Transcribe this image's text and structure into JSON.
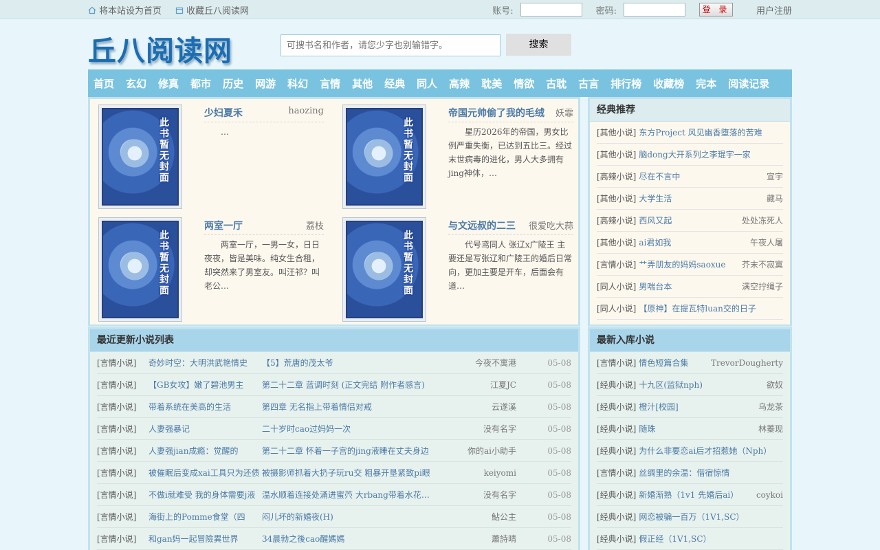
{
  "topbar": {
    "set_home": "将本站设为首页",
    "bookmark": "收藏丘八阅读网",
    "account_label": "账号:",
    "password_label": "密码:",
    "login_button": "登 录",
    "register": "用户注册"
  },
  "header": {
    "logo": "丘八阅读网",
    "search_placeholder": "可搜书名和作者，请您少字也别输错字。",
    "search_button": "搜索"
  },
  "nav": [
    "首页",
    "玄幻",
    "修真",
    "都市",
    "历史",
    "网游",
    "科幻",
    "言情",
    "其他",
    "经典",
    "同人",
    "高辣",
    "耽美",
    "情欲",
    "古耽",
    "古言",
    "排行榜",
    "收藏榜",
    "完本",
    "阅读记录"
  ],
  "cover_text": "此书暂无封面",
  "featured": [
    {
      "title": "少妇夏禾",
      "author": "haozing",
      "desc": "…"
    },
    {
      "title": "帝国元帅偷了我的毛绒",
      "author": "妖霏",
      "desc": "星历2026年的帝国，男女比例严重失衡，已达到五比三。经过末世病毒的进化，男人大多拥有jing神体，…"
    },
    {
      "title": "两室一厅",
      "author": "荔枝",
      "desc": "两室一厅，一男一女，日日夜夜，皆是美味。纯女生合租，却突然来了男室友。叫汪祁？叫老公…"
    },
    {
      "title": "与文远叔的二三",
      "author": "很爱吃大蒜",
      "desc": "代号鸢同人 张辽x广陵王 主要还是写张辽和广陵王的婚后日常向，更加主要是开车，后面会有道…"
    }
  ],
  "classic": {
    "heading": "经典推荐",
    "items": [
      {
        "cat": "[其他小说]",
        "title": "东方Project 风见幽香堕落的苦难",
        "author": ""
      },
      {
        "cat": "[其他小说]",
        "title": "脑dong大开系列之李琨宇一家",
        "author": ""
      },
      {
        "cat": "[高辣小说]",
        "title": "尽在不言中",
        "author": "宣宇"
      },
      {
        "cat": "[其他小说]",
        "title": "大学生活",
        "author": "藏马"
      },
      {
        "cat": "[高辣小说]",
        "title": "西风又起",
        "author": "处处冻死人"
      },
      {
        "cat": "[其他小说]",
        "title": "ai君如我",
        "author": "午夜人屠"
      },
      {
        "cat": "[言情小说]",
        "title": "艹弄朋友的妈妈saoxue",
        "author": "芥末不寂寞"
      },
      {
        "cat": "[同人小说]",
        "title": "男喘台本",
        "author": "满空拧绳子"
      },
      {
        "cat": "[同人小说]",
        "title": "【原神】在提瓦特luan交的日子",
        "author": ""
      }
    ]
  },
  "latest": {
    "heading": "最近更新小说列表",
    "rows": [
      {
        "cat": "[言情小说]",
        "title": "奇妙时空：大明洪武艳情史",
        "chapter": "【5】荒唐的茂太爷",
        "author": "今夜不寓港",
        "date": "05-08"
      },
      {
        "cat": "[言情小说]",
        "title": "【GB女攻】嫩了碧池男主",
        "chapter": "第二十二章 蓝调时刻 (正文完结 附作者感言)",
        "author": "江夏JC",
        "date": "05-08"
      },
      {
        "cat": "[言情小说]",
        "title": "带着系统在美高的生活",
        "chapter": "第四章 无名指上带着情侣对戒",
        "author": "云遂溪",
        "date": "05-08"
      },
      {
        "cat": "[言情小说]",
        "title": "人妻强暴记",
        "chapter": "二十岁时cao过妈妈一次",
        "author": "没有名字",
        "date": "05-08"
      },
      {
        "cat": "[言情小说]",
        "title": "人妻强jian成瘾：觉醒的",
        "chapter": "第二十二章 怀着一子宫的jing液睡在丈夫身边",
        "author": "你的ai小助手",
        "date": "05-08"
      },
      {
        "cat": "[言情小说]",
        "title": "被催眠后变成xai工具只为还债",
        "chapter": "被摄影师抓着大扔子玩ru交 粗暴开垦紧致pi眼",
        "author": "keiyomi",
        "date": "05-08"
      },
      {
        "cat": "[言情小说]",
        "title": "不做i就难受 我的身体需要j液",
        "chapter": "温水顺着连接处涌进蜜茓 大rbang带着水花在saobi…",
        "author": "没有名字",
        "date": "05-08"
      },
      {
        "cat": "[言情小说]",
        "title": "海街上的Pomme食堂（四",
        "chapter": "闷儿坏的新婚夜(H)",
        "author": "鮎公主",
        "date": "05-08"
      },
      {
        "cat": "[言情小说]",
        "title": "和gan妈一起冒險異世界",
        "chapter": "34晨勃之後cao醒媽媽",
        "author": "蕭詩晴",
        "date": "05-08"
      }
    ]
  },
  "newin": {
    "heading": "最新入库小说",
    "items": [
      {
        "cat": "[言情小说]",
        "title": "情色短篇合集",
        "author": "TrevorDougherty"
      },
      {
        "cat": "[经典小说]",
        "title": "十九区(监狱nph)",
        "author": "欲奴"
      },
      {
        "cat": "[经典小说]",
        "title": "橙汁[校园]",
        "author": "乌龙茶"
      },
      {
        "cat": "[经典小说]",
        "title": "随珠",
        "author": "林蓁现"
      },
      {
        "cat": "[经典小说]",
        "title": "为什么非要恋ai后才招惹她（Nph）",
        "author": ""
      },
      {
        "cat": "[言情小说]",
        "title": "丝绸里的余温：借宿惊情",
        "author": ""
      },
      {
        "cat": "[经典小说]",
        "title": "新婚渐熟（1v1 先婚后ai）",
        "author": "coykoi"
      },
      {
        "cat": "[经典小说]",
        "title": "网恋被骗一百万（1V1,SC）",
        "author": ""
      },
      {
        "cat": "[经典小说]",
        "title": "假正经（1V1,SC）",
        "author": ""
      }
    ]
  }
}
